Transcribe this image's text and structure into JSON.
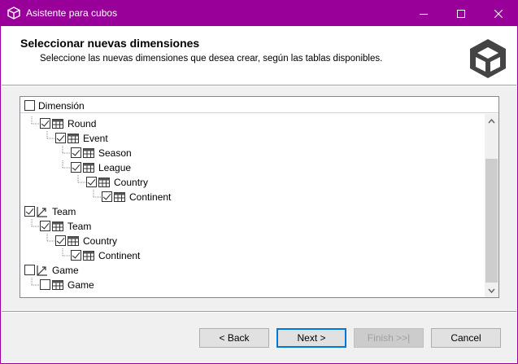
{
  "window": {
    "title": "Asistente para cubos",
    "accent": "#990099"
  },
  "header": {
    "title": "Seleccionar nuevas dimensiones",
    "subtitle": "Seleccione las nuevas dimensiones que desea crear, según las tablas disponibles."
  },
  "tree": {
    "root_label": "Dimensión",
    "items": [
      {
        "label": "Round",
        "checked": true,
        "icon": "table-icon"
      },
      {
        "label": "Event",
        "checked": true,
        "icon": "table-icon"
      },
      {
        "label": "Season",
        "checked": true,
        "icon": "table-icon"
      },
      {
        "label": "League",
        "checked": true,
        "icon": "table-icon"
      },
      {
        "label": "Country",
        "checked": true,
        "icon": "table-icon"
      },
      {
        "label": "Continent",
        "checked": true,
        "icon": "table-icon"
      },
      {
        "label": "Team",
        "checked": true,
        "icon": "dimension-icon"
      },
      {
        "label": "Team",
        "checked": true,
        "icon": "table-icon"
      },
      {
        "label": "Country",
        "checked": true,
        "icon": "table-icon"
      },
      {
        "label": "Continent",
        "checked": true,
        "icon": "table-icon"
      },
      {
        "label": "Game",
        "checked": false,
        "icon": "dimension-icon"
      },
      {
        "label": "Game",
        "checked": false,
        "icon": "table-icon"
      }
    ]
  },
  "buttons": {
    "back": "< Back",
    "next": "Next >",
    "finish": ">>|",
    "finish_full": "Finish >>|",
    "cancel": "Cancel"
  }
}
